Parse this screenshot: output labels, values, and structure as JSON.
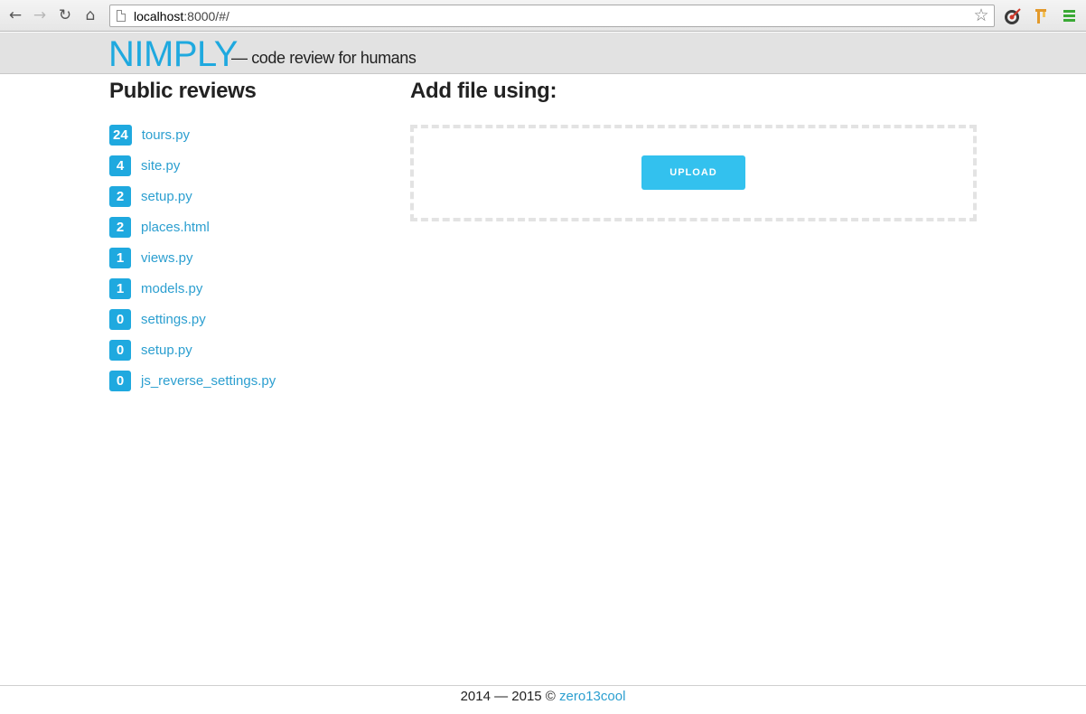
{
  "browser": {
    "url_host": "localhost",
    "url_path": ":8000/#/",
    "icons": [
      "back-icon",
      "forward-icon",
      "reload-icon",
      "home-icon",
      "page-icon",
      "star-icon",
      "extension-icon",
      "extension-icon",
      "menu-icon"
    ]
  },
  "header": {
    "logo": "NIMPLY",
    "tagline": "— code review for humans",
    "logo_color": "#1fa9df"
  },
  "reviews": {
    "title": "Public reviews",
    "items": [
      {
        "count": "24",
        "file": "tours.py"
      },
      {
        "count": "4",
        "file": "site.py"
      },
      {
        "count": "2",
        "file": "setup.py"
      },
      {
        "count": "2",
        "file": "places.html"
      },
      {
        "count": "1",
        "file": "views.py"
      },
      {
        "count": "1",
        "file": "models.py"
      },
      {
        "count": "0",
        "file": "settings.py"
      },
      {
        "count": "0",
        "file": "setup.py"
      },
      {
        "count": "0",
        "file": "js_reverse_settings.py"
      }
    ]
  },
  "add_file": {
    "title": "Add file using:",
    "upload_label": "UPLOAD",
    "upload_color": "#33c1ee"
  },
  "footer": {
    "text": "2014 — 2015 ©",
    "link": "zero13cool"
  }
}
